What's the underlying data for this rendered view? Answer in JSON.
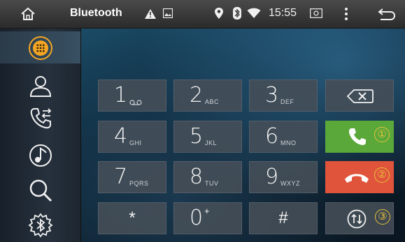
{
  "statusbar": {
    "title": "Bluetooth",
    "time": "15:55",
    "icons": [
      "home-icon",
      "warning-icon",
      "image-icon",
      "location-icon",
      "bluetooth-icon",
      "wifi-icon",
      "screenshot-icon",
      "menu-icon",
      "back-icon"
    ]
  },
  "sidebar": {
    "items": [
      {
        "icon": "dialpad-icon",
        "active": true
      },
      {
        "icon": "contacts-icon",
        "active": false
      },
      {
        "icon": "call-log-icon",
        "active": false
      },
      {
        "icon": "music-icon",
        "active": false
      },
      {
        "icon": "search-icon",
        "active": false
      },
      {
        "icon": "bluetooth-settings-icon",
        "active": false
      }
    ]
  },
  "keypad": {
    "keys": [
      {
        "digit": "1",
        "sub": "voicemail-icon"
      },
      {
        "digit": "2",
        "sub": "ABC"
      },
      {
        "digit": "3",
        "sub": "DEF"
      },
      {
        "digit": "4",
        "sub": "GHI"
      },
      {
        "digit": "5",
        "sub": "JKL"
      },
      {
        "digit": "6",
        "sub": "MNO"
      },
      {
        "digit": "7",
        "sub": "PQRS"
      },
      {
        "digit": "8",
        "sub": "TUV"
      },
      {
        "digit": "9",
        "sub": "WXYZ"
      },
      {
        "digit": "*"
      },
      {
        "digit": "0",
        "sup": "+"
      },
      {
        "digit": "#"
      }
    ]
  },
  "actions": {
    "delete_icon": "backspace-icon",
    "call_badge": "①",
    "end_badge": "②",
    "swap_badge": "③",
    "call_color": "#5aa83a",
    "end_color": "#e0543c",
    "badge_color": "#e7c23a"
  }
}
